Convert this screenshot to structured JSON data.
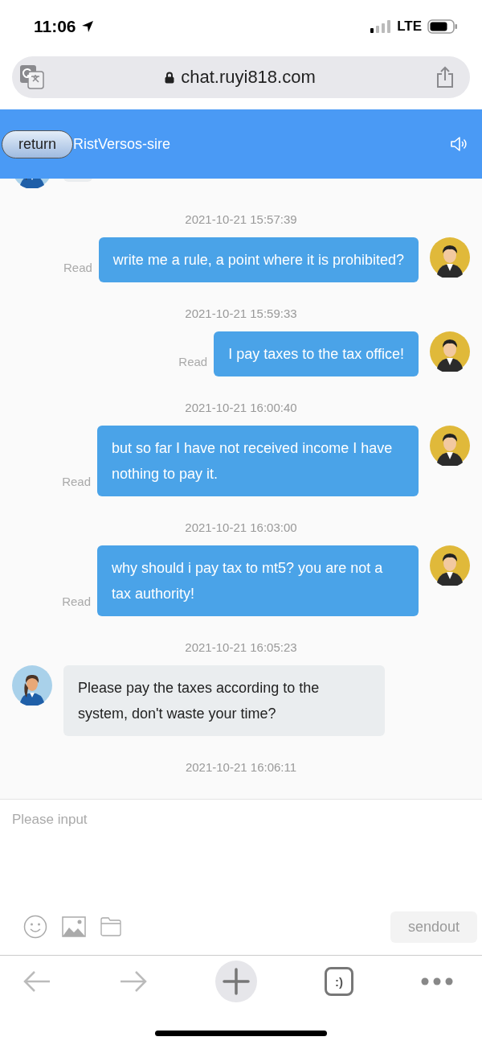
{
  "status_bar": {
    "time": "11:06",
    "network": "LTE"
  },
  "browser": {
    "url": "chat.ruyi818.com",
    "tab_switcher": ":)"
  },
  "header": {
    "back_button": "return",
    "title": "RistVersos-sire"
  },
  "messages": [
    {
      "kind": "partial"
    },
    {
      "kind": "time",
      "text": "2021-10-21 15:57:39"
    },
    {
      "kind": "sent",
      "text": "write me a rule, a point where it is prohibited?",
      "status": "Read"
    },
    {
      "kind": "time",
      "text": "2021-10-21 15:59:33"
    },
    {
      "kind": "sent",
      "text": "I pay taxes to the tax office!",
      "status": "Read"
    },
    {
      "kind": "time",
      "text": "2021-10-21 16:00:40"
    },
    {
      "kind": "sent",
      "text": "but so far I have not received income I have nothing to pay it.",
      "status": "Read"
    },
    {
      "kind": "time",
      "text": "2021-10-21 16:03:00"
    },
    {
      "kind": "sent",
      "text": "why should i pay tax to mt5? you are not a tax authority!",
      "status": "Read"
    },
    {
      "kind": "time",
      "text": "2021-10-21 16:05:23"
    },
    {
      "kind": "received",
      "text": "Please pay the taxes according to the system, don't waste your time?"
    },
    {
      "kind": "time",
      "text": "2021-10-21 16:06:11"
    }
  ],
  "composer": {
    "placeholder": "Please input",
    "send_button": "sendout",
    "send_disabled": true
  }
}
